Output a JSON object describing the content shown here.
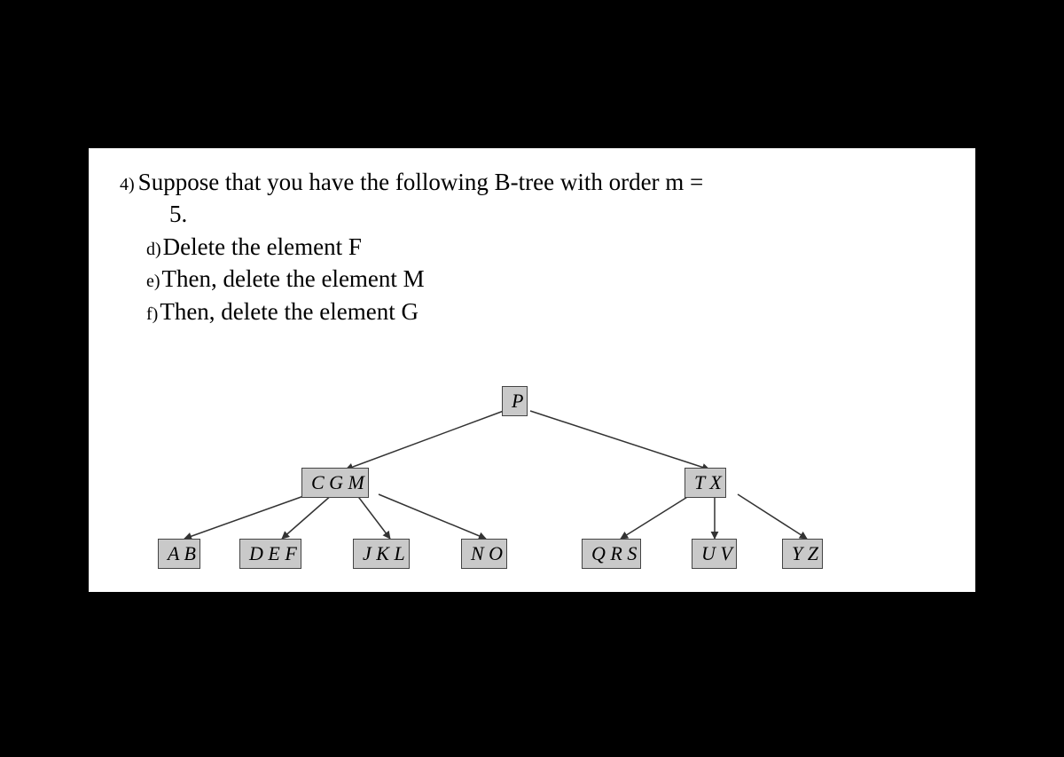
{
  "question": {
    "number": "4)",
    "prompt_line1": "Suppose that you have the following B-tree with order m =",
    "prompt_line2": "5.",
    "parts": [
      {
        "label": "d)",
        "text": "Delete the element F"
      },
      {
        "label": "e)",
        "text": "Then, delete the element M"
      },
      {
        "label": "f)",
        "text": "Then, delete the element G"
      }
    ]
  },
  "btree": {
    "order": 5,
    "root": {
      "keys": "P"
    },
    "level2": [
      {
        "keys": "C G M"
      },
      {
        "keys": "T X"
      }
    ],
    "leaves": [
      {
        "keys": "A B"
      },
      {
        "keys": "D E F"
      },
      {
        "keys": "J K L"
      },
      {
        "keys": "N O"
      },
      {
        "keys": "Q R S"
      },
      {
        "keys": "U V"
      },
      {
        "keys": "Y Z"
      }
    ]
  }
}
